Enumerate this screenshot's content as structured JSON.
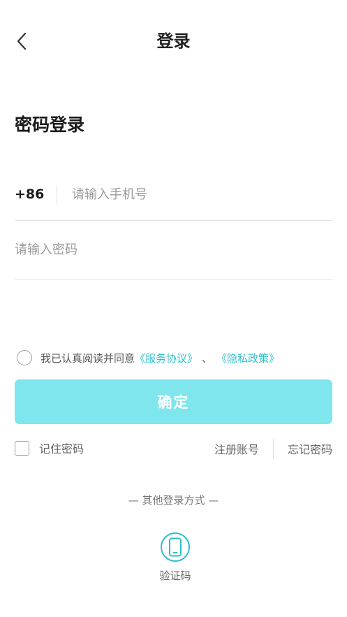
{
  "header": {
    "title": "登录",
    "back_icon": "chevron-left-icon"
  },
  "form": {
    "section_title": "密码登录",
    "country_code": "+86",
    "phone_placeholder": "请输入手机号",
    "password_placeholder": "请输入密码"
  },
  "agreement": {
    "checked": false,
    "prefix": "我已认真阅读并同意",
    "service_link": "《服务协议》",
    "separator": "、",
    "privacy_link": "《隐私政策》"
  },
  "confirm_label": "确定",
  "options": {
    "remember_label": "记住密码",
    "remember_checked": false,
    "register_label": "注册账号",
    "forgot_label": "忘记密码"
  },
  "other_login": {
    "title": "— 其他登录方式 —",
    "methods": [
      {
        "label": "验证码",
        "icon": "mobile-phone-icon"
      }
    ]
  },
  "colors": {
    "accent": "#2bbfcc",
    "button_bg": "#80e6ee",
    "divider": "#e3e3e3"
  }
}
